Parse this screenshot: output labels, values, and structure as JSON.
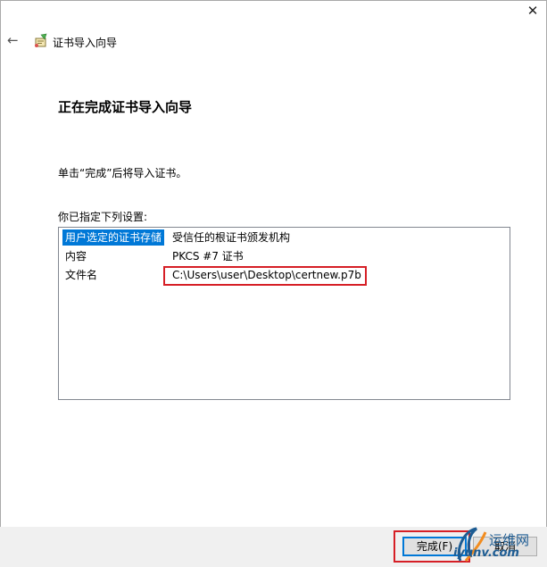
{
  "window": {
    "close_glyph": "✕"
  },
  "header": {
    "back_glyph": "←",
    "wizard_title": "证书导入向导"
  },
  "main": {
    "heading": "正在完成证书导入向导",
    "instruction": "单击“完成”后将导入证书。",
    "settings_label": "你已指定下列设置:",
    "settings": [
      {
        "key": "用户选定的证书存储",
        "value": "受信任的根证书颁发机构"
      },
      {
        "key": "内容",
        "value": "PKCS #7 证书"
      },
      {
        "key": "文件名",
        "value": "C:\\Users\\user\\Desktop\\certnew.p7b"
      }
    ]
  },
  "footer": {
    "finish_label": "完成(F)",
    "cancel_label": "取消"
  },
  "watermark": {
    "top_text": "运维网",
    "bottom_text": "iyunv.com"
  },
  "colors": {
    "selection": "#0078d7",
    "annotation_red": "#d61f26"
  }
}
